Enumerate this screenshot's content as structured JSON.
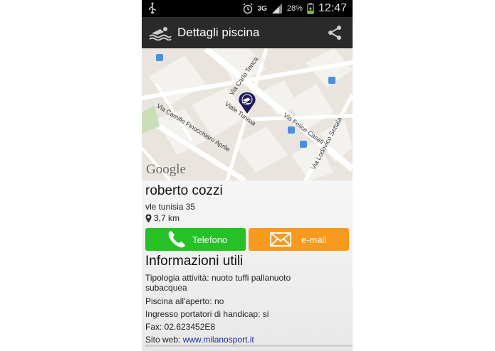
{
  "status_bar": {
    "battery": "28%",
    "time": "12:47",
    "network": "3G"
  },
  "action_bar": {
    "title": "Dettagli piscina"
  },
  "map": {
    "streets": [
      "Via Carlo Tenca",
      "Viale Tunisia",
      "Via Felice Casati",
      "Via Camillo Finocchiaro Aprile",
      "Via Lodovico Settala"
    ],
    "attribution": "Google"
  },
  "place": {
    "name": "roberto cozzi",
    "address": "vle tunisia 35",
    "distance": "3,7 km"
  },
  "buttons": {
    "phone": "Telefono",
    "email": "e-mail"
  },
  "info": {
    "title": "Informazioni utili",
    "type_label": "Tipologia attività:",
    "type_value": "nuoto tuffi pallanuoto subacquea",
    "outdoor": "Piscina all'aperto: no",
    "handicap": "Ingresso portatori di handicap: si",
    "fax": "Fax: 02.623452E8",
    "website_label": "Sito web:",
    "website": "www.milanosport.it"
  },
  "colors": {
    "phone_button": "#26c126",
    "email_button": "#f79a1d",
    "action_bar": "#2a2a2a",
    "marker": "#1e1b5c"
  }
}
